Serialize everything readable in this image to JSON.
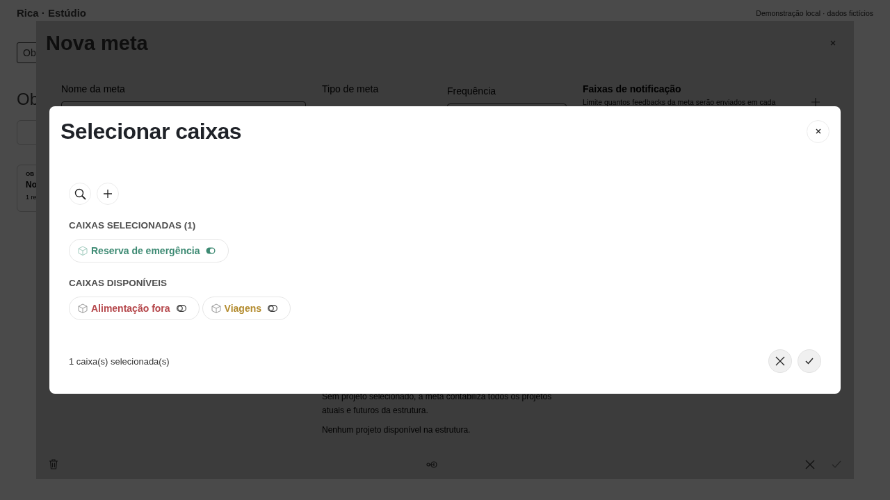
{
  "page": {
    "brand": "Rica · Estúdio",
    "notice": "Demonstração local · dados fictícios",
    "tab": "Ob",
    "heading": "Ob",
    "card": {
      "eyebrow": "OB",
      "title": "No",
      "meta": "1 re"
    }
  },
  "goal_dialog": {
    "title": "Nova meta",
    "fields": [
      {
        "label": "Nome da meta"
      },
      {
        "label": "Tipo de meta"
      },
      {
        "label": "Frequência"
      }
    ],
    "notification": {
      "title": "Faixas de notificação",
      "description": "Limite quantos feedbacks da meta serão enviados em cada"
    },
    "project_note": [
      "Sem projeto selecionado, a meta contabiliza todos os projetos",
      "atuais e futuros da estrutura."
    ],
    "empty_projects": "Nenhum projeto disponível na estrutura."
  },
  "box_dialog": {
    "title": "Selecionar caixas",
    "sections": [
      {
        "heading": "CAIXAS SELECIONADAS (1)",
        "boxes": [
          {
            "name": "Reserva de emergência",
            "color": "#3d8a73",
            "selected": true
          }
        ]
      },
      {
        "heading": "CAIXAS DISPONÍVEIS",
        "boxes": [
          {
            "name": "Alimentação fora",
            "color": "#b5474b",
            "selected": false
          },
          {
            "name": "Viagens",
            "color": "#b38b2e",
            "selected": false
          }
        ]
      }
    ],
    "footer": "1 caixa(s) selecionada(s)"
  }
}
